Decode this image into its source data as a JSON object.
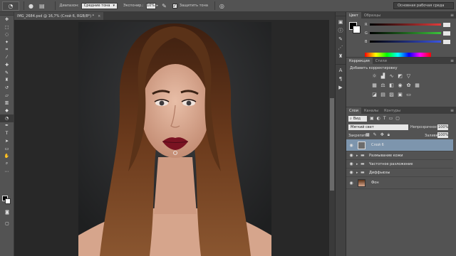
{
  "options_bar": {
    "range_label": "Диапазон:",
    "range_value": "Средние тона",
    "exposure_label": "Экспонир.:",
    "exposure_value": "10%",
    "protect_tones_label": "Защитить тона",
    "workspace_label": "Основная рабочая среда"
  },
  "document": {
    "tab_title": "IMG_2684.psd @ 16,7% (Слой 6, RGB/8*) *",
    "close_glyph": "×"
  },
  "color_panel": {
    "tabs": [
      "Цвет",
      "Образцы"
    ],
    "channels": [
      "R",
      "G",
      "B"
    ],
    "colors": {
      "r": "#e23b3b",
      "g": "#3cc23c",
      "b": "#3b55e2"
    }
  },
  "adjustments_panel": {
    "tabs": [
      "Коррекция",
      "Стили"
    ],
    "title": "Добавить корректировку"
  },
  "layers_panel": {
    "tabs": [
      "Слои",
      "Каналы",
      "Контуры"
    ],
    "filter_value": "Вид",
    "blend_mode": "Мягкий свет",
    "opacity_label": "Непрозрачность:",
    "opacity_value": "100%",
    "lock_label": "Закрепить:",
    "fill_label": "Заливка:",
    "fill_value": "100%",
    "layers": [
      {
        "name": "Слой 6",
        "type": "layer",
        "selected": true
      },
      {
        "name": "Размывание кожи",
        "type": "group",
        "selected": false
      },
      {
        "name": "Частотное разложение",
        "type": "group",
        "selected": false
      },
      {
        "name": "Диффьюзы",
        "type": "group",
        "selected": false
      },
      {
        "name": "Фон",
        "type": "photo",
        "selected": false
      }
    ]
  },
  "canvas": {
    "background_color": "#242526",
    "hair_color": "#5a3218",
    "skin_color": "#d9a78e",
    "lip_color": "#7a1322"
  }
}
